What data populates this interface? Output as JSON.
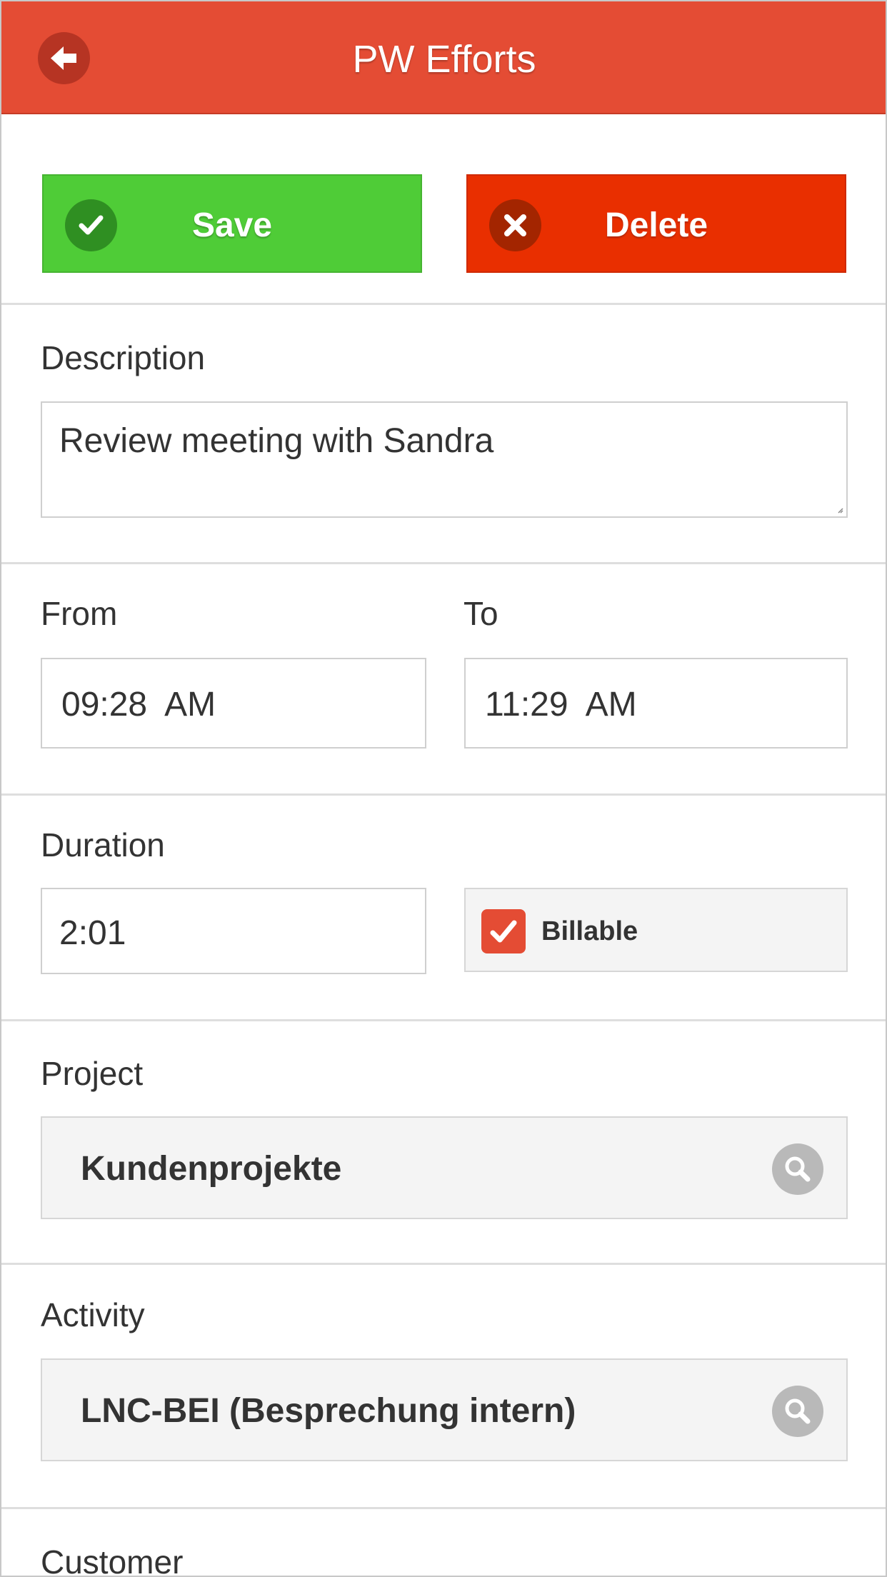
{
  "header": {
    "title": "PW Efforts",
    "back_icon": "arrow-left-icon"
  },
  "actions": {
    "save_label": "Save",
    "delete_label": "Delete",
    "save_color": "#4fcc37",
    "delete_color": "#e92f00"
  },
  "form": {
    "description": {
      "label": "Description",
      "value": "Review meeting with Sandra"
    },
    "from": {
      "label": "From",
      "value": "09:28  AM"
    },
    "to": {
      "label": "To",
      "value": "11:29  AM"
    },
    "duration": {
      "label": "Duration",
      "value": "2:01"
    },
    "billable": {
      "label": "Billable",
      "checked": true
    },
    "project": {
      "label": "Project",
      "value": "Kundenprojekte"
    },
    "activity": {
      "label": "Activity",
      "value": "LNC-BEI (Besprechung intern)"
    },
    "customer": {
      "label": "Customer"
    }
  },
  "theme": {
    "accent": "#e44c34"
  }
}
